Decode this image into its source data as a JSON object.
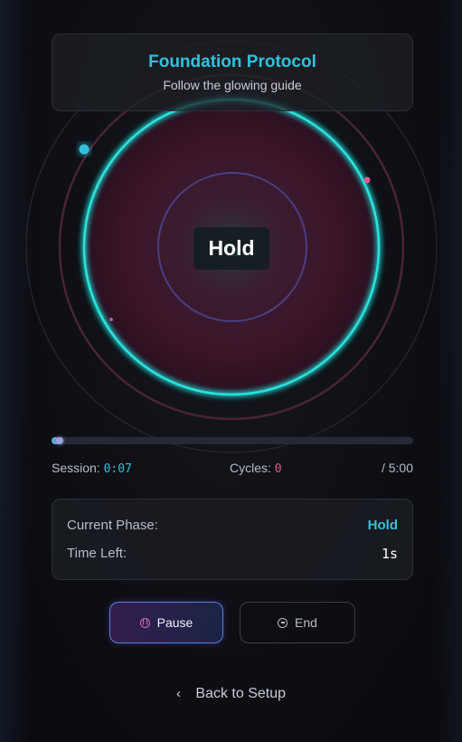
{
  "header": {
    "title": "Foundation Protocol",
    "subtitle": "Follow the glowing guide"
  },
  "breath": {
    "phase": "Hold",
    "colors": {
      "accent": "#2ec3dc",
      "pink": "#e0598e",
      "inner_ring": "#4a3f86"
    }
  },
  "progress": {
    "fraction": 0.023
  },
  "stats": {
    "session_label": "Session:",
    "session_value": "0:07",
    "cycles_label": "Cycles:",
    "cycles_value": "0",
    "total": "/ 5:00"
  },
  "panel": {
    "phase_label": "Current Phase:",
    "phase_value": "Hold",
    "time_label": "Time Left:",
    "time_value": "1s"
  },
  "controls": {
    "pause_label": "Pause",
    "end_label": "End",
    "pause_icon": "pause-circle-icon",
    "end_icon": "stop-circle-icon"
  },
  "back": {
    "label": "Back to Setup",
    "icon": "chevron-left-icon"
  }
}
